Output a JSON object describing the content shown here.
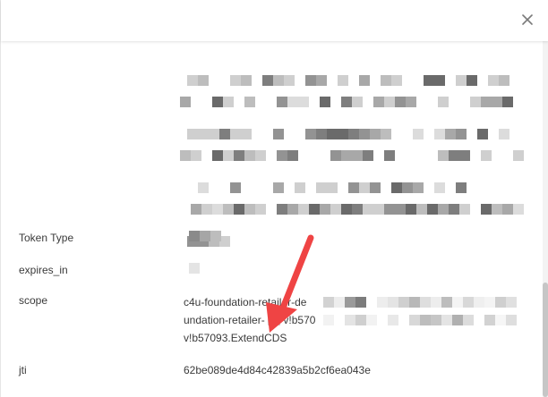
{
  "dialog": {
    "close_icon": "close-icon"
  },
  "fields": [
    {
      "label": "Token Type",
      "value": ""
    },
    {
      "label": "expires_in",
      "value": ""
    },
    {
      "label": "scope",
      "lines": [
        "c4u-foundation-retailer-de",
        "undation-retailer-",
        "v!b57093.ExtendCDS"
      ]
    },
    {
      "label": "jti",
      "value": "62be089de4d84c42839a5b2cf6ea043e"
    }
  ],
  "colors": {
    "annotation_arrow": "#ef4444",
    "redaction": "#9e9e9e"
  }
}
